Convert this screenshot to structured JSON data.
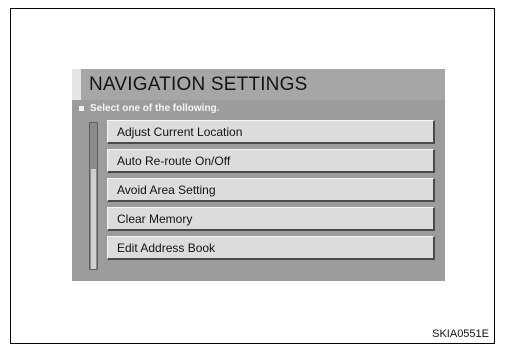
{
  "screen": {
    "title": "NAVIGATION SETTINGS",
    "prompt": "Select one of the following.",
    "menu_items": [
      "Adjust Current Location",
      "Auto Re-route On/Off",
      "Avoid Area Setting",
      "Clear Memory",
      "Edit Address Book"
    ]
  },
  "figure": {
    "code": "SKIA0551E"
  }
}
